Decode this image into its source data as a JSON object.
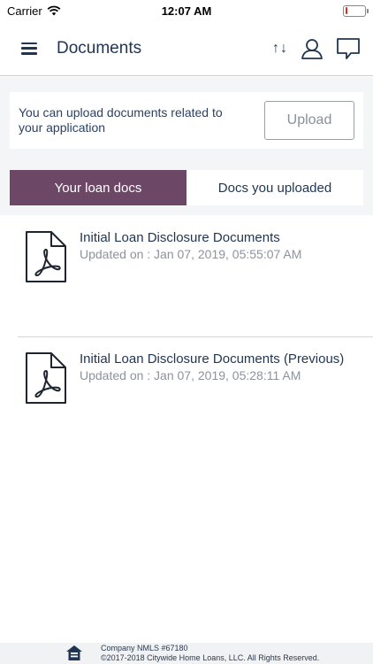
{
  "status_bar": {
    "carrier": "Carrier",
    "time": "12:07 AM",
    "battery_level": 0.12
  },
  "header": {
    "title": "Documents",
    "menu_icon": "hamburger-menu-icon",
    "sort_label": "↑↓",
    "profile_icon": "user-icon",
    "chat_icon": "chat-bubble-icon"
  },
  "upload": {
    "message": "You can upload documents related to your application",
    "button_label": "Upload"
  },
  "tabs": [
    {
      "label": "Your loan docs",
      "active": true
    },
    {
      "label": "Docs you uploaded",
      "active": false
    }
  ],
  "documents": [
    {
      "title": "Initial Loan Disclosure Documents",
      "updated": "Updated on : Jan 07, 2019, 05:55:07 AM",
      "icon": "pdf-file-icon"
    },
    {
      "title": "Initial Loan Disclosure Documents (Previous)",
      "updated": "Updated on : Jan 07, 2019, 05:28:11 AM",
      "icon": "pdf-file-icon"
    }
  ],
  "footer": {
    "nmls": "Company NMLS #67180",
    "copyright": "©2017-2018 Citywide Home Loans, LLC. All Rights Reserved.",
    "icon": "equal-housing-lender-icon"
  },
  "colors": {
    "primary_text": "#1f3552",
    "active_tab": "#6d4766",
    "secondary_text": "#8d939b",
    "battery_low": "#e0262b"
  }
}
